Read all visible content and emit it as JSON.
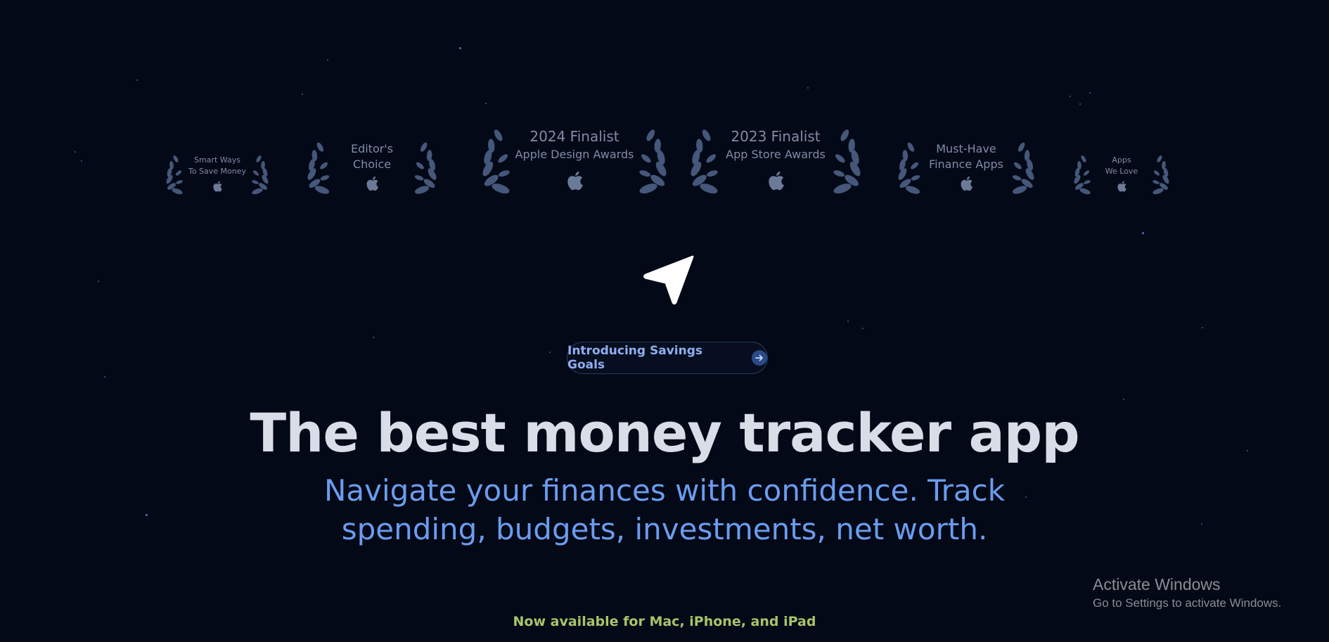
{
  "awards": [
    {
      "line1": "Smart Ways",
      "line2": "To Save Money",
      "icon": "apple-icon"
    },
    {
      "line1": "Editor's",
      "line2": "Choice",
      "icon": "apple-icon"
    },
    {
      "line1": "2024 Finalist",
      "line2": "Apple Design Awards",
      "icon": "apple-icon"
    },
    {
      "line1": "2023 Finalist",
      "line2": "App Store Awards",
      "icon": "apple-icon"
    },
    {
      "line1": "Must-Have",
      "line2": "Finance Apps",
      "icon": "apple-icon"
    },
    {
      "line1": "Apps",
      "line2": "We Love",
      "icon": "apple-icon"
    }
  ],
  "logo": {
    "icon": "navigation-arrow-icon"
  },
  "announcement": {
    "label": "Introducing Savings Goals",
    "icon": "arrow-right-icon"
  },
  "hero": {
    "headline": "The best money tracker app",
    "subheadline_line1": "Navigate your finances with confidence. Track",
    "subheadline_line2": "spending, budgets, investments, net worth."
  },
  "availability": "Now available for Mac, iPhone, and iPad",
  "windows_watermark": {
    "title": "Activate Windows",
    "subtitle": "Go to Settings to activate Windows."
  },
  "colors": {
    "background": "#030916",
    "headline": "#d9dde8",
    "subheadline": "#6b9cf0",
    "availability": "#a8c56a",
    "award_text": "#7f8ca8"
  }
}
